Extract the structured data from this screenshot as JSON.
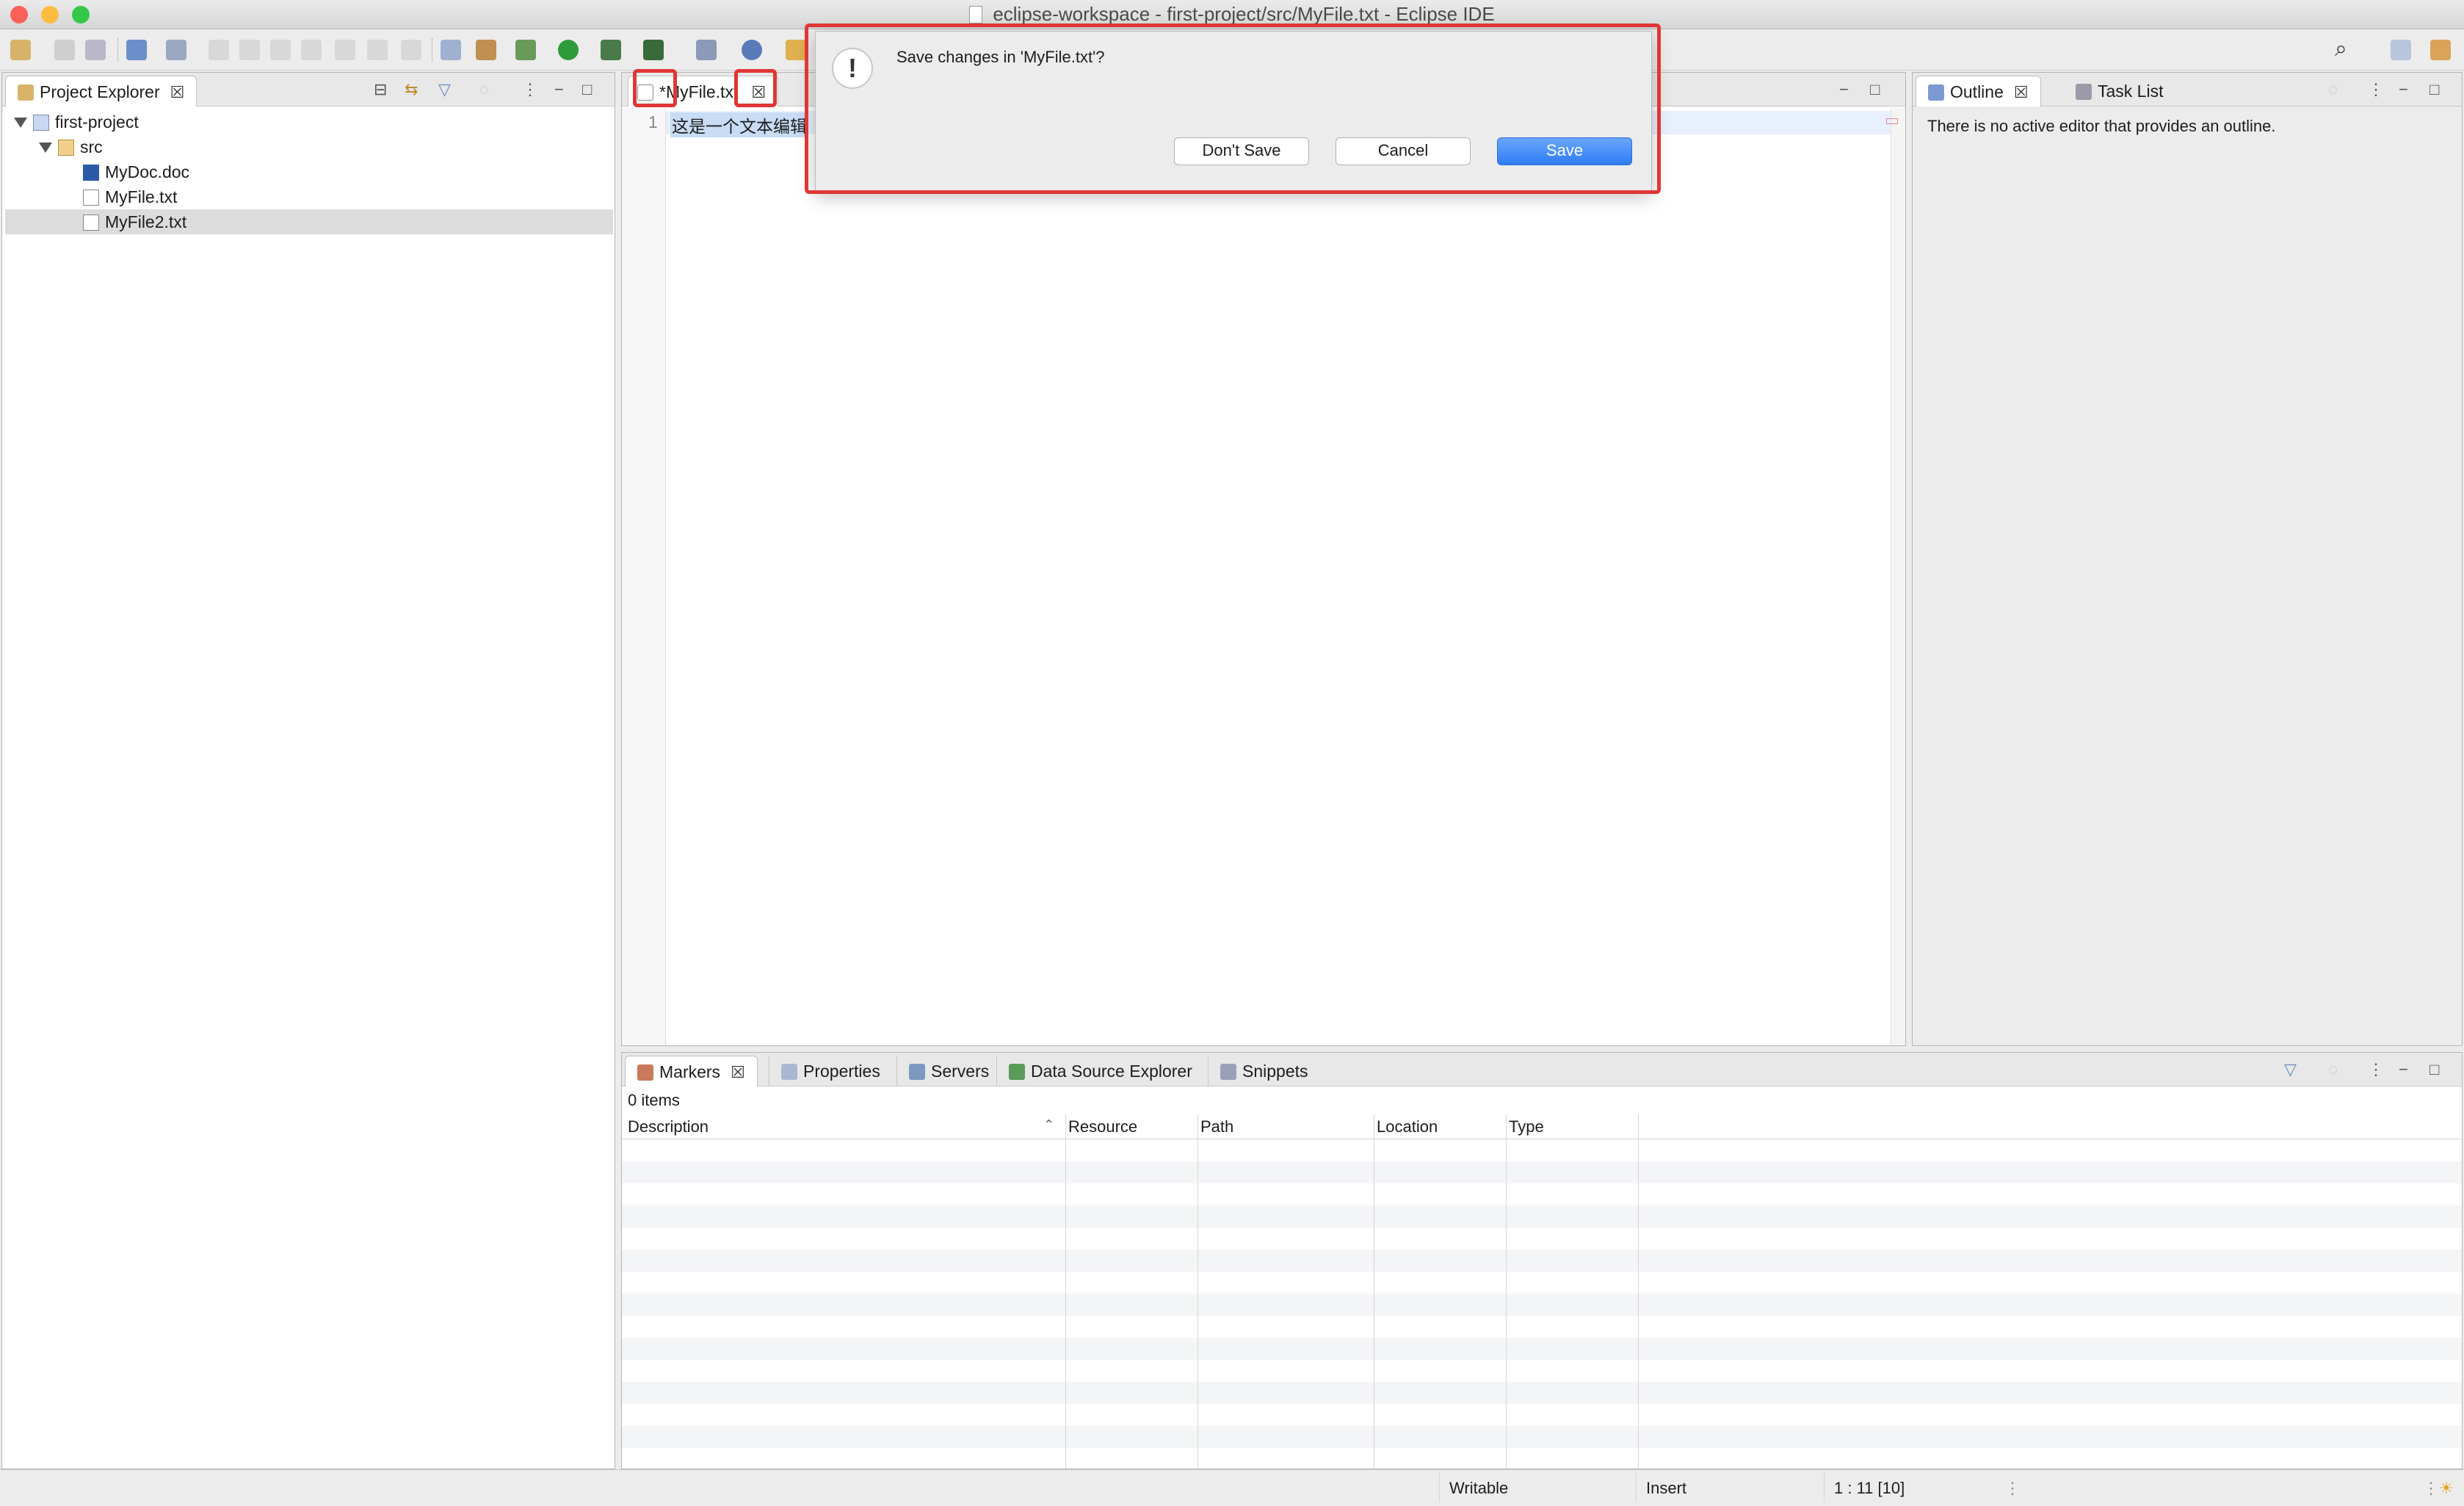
{
  "window": {
    "title": "eclipse-workspace - first-project/src/MyFile.txt - Eclipse IDE"
  },
  "project_explorer": {
    "tab_label": "Project Explorer",
    "tree": [
      {
        "label": "first-project",
        "icon": "project-folder-icon"
      },
      {
        "label": "src",
        "icon": "folder-icon"
      },
      {
        "label": "MyDoc.doc",
        "icon": "word-doc-icon"
      },
      {
        "label": "MyFile.txt",
        "icon": "text-file-icon"
      },
      {
        "label": "MyFile2.txt",
        "icon": "text-file-icon"
      }
    ]
  },
  "editor": {
    "tab_label": "*MyFile.txt",
    "line_number": "1",
    "line_text": "这是一个文本编辑"
  },
  "outline": {
    "tabs": [
      "Outline",
      "Task List"
    ],
    "message": "There is no active editor that provides an outline."
  },
  "dialog": {
    "message": "Save changes in 'MyFile.txt'?",
    "icon": "warning-exclamation-icon",
    "buttons": {
      "dont_save": "Don't Save",
      "cancel": "Cancel",
      "save": "Save"
    }
  },
  "bottom_panel": {
    "tabs": [
      "Markers",
      "Properties",
      "Servers",
      "Data Source Explorer",
      "Snippets"
    ],
    "count": "0 items",
    "columns": [
      "Description",
      "Resource",
      "Path",
      "Location",
      "Type"
    ]
  },
  "status": {
    "writable": "Writable",
    "insert": "Insert",
    "position": "1 : 11 [10]"
  },
  "colors": {
    "highlight": "#e03636",
    "primary_button": "#2f7cf6",
    "selection": "#c8dcf5"
  }
}
